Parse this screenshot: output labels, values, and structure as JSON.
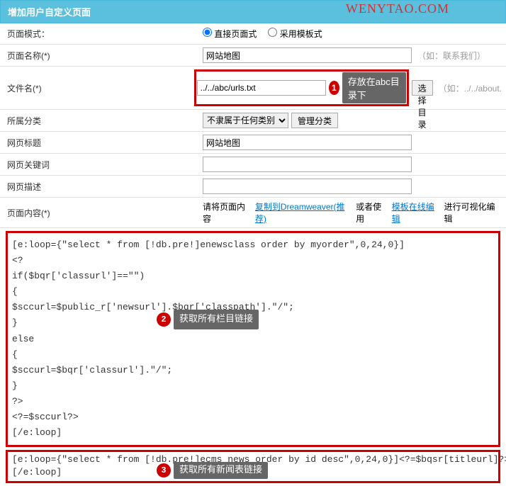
{
  "watermark": "WENYTAO.COM",
  "header": "增加用户自定义页面",
  "rows": {
    "mode": {
      "label": "页面模式：",
      "opt1": "直接页面式",
      "opt2": "采用模板式"
    },
    "name": {
      "label": "页面名称(*)",
      "value": "网站地图",
      "hint": "（如：联系我们）"
    },
    "file": {
      "label": "文件名(*)",
      "value": "../../abc/urls.txt",
      "btn": "选择目录",
      "hint": "（如：../../about."
    },
    "cat": {
      "label": "所属分类",
      "select": "不隶属于任何类别",
      "btn": "管理分类"
    },
    "title": {
      "label": "网页标题",
      "value": "网站地图"
    },
    "keywords": {
      "label": "网页关键词",
      "value": ""
    },
    "desc": {
      "label": "网页描述",
      "value": ""
    },
    "content": {
      "label": "页面内容(*)",
      "t1": "请将页面内容",
      "l1": "复制到Dreamweaver(推荐)",
      "t2": "或者使用",
      "l2": "模板在线编辑",
      "t3": "进行可视化编辑"
    }
  },
  "callouts": {
    "c1": {
      "num": "1",
      "text": "存放在abc目录下"
    },
    "c2": {
      "num": "2",
      "text": "获取所有栏目链接"
    },
    "c3": {
      "num": "3",
      "text": "获取所有新闻表链接"
    }
  },
  "code1": [
    "[e:loop={\"select * from [!db.pre!]enewsclass order by myorder\",0,24,0}]",
    "<?",
    "if($bqr['classurl']==\"\")",
    "{",
    "$sccurl=$public_r['newsurl'].$bqr['classpath'].\"/\";",
    "}",
    "else",
    "{",
    "$sccurl=$bqr['classurl'].\"/\";",
    "}",
    "?>",
    "<?=$sccurl?>",
    "",
    "[/e:loop]"
  ],
  "code2": [
    "[e:loop={\"select * from [!db.pre!]ecms_news order by id desc\",0,24,0}]<?=$bqsr[titleurl]?>",
    "",
    "[/e:loop]"
  ]
}
